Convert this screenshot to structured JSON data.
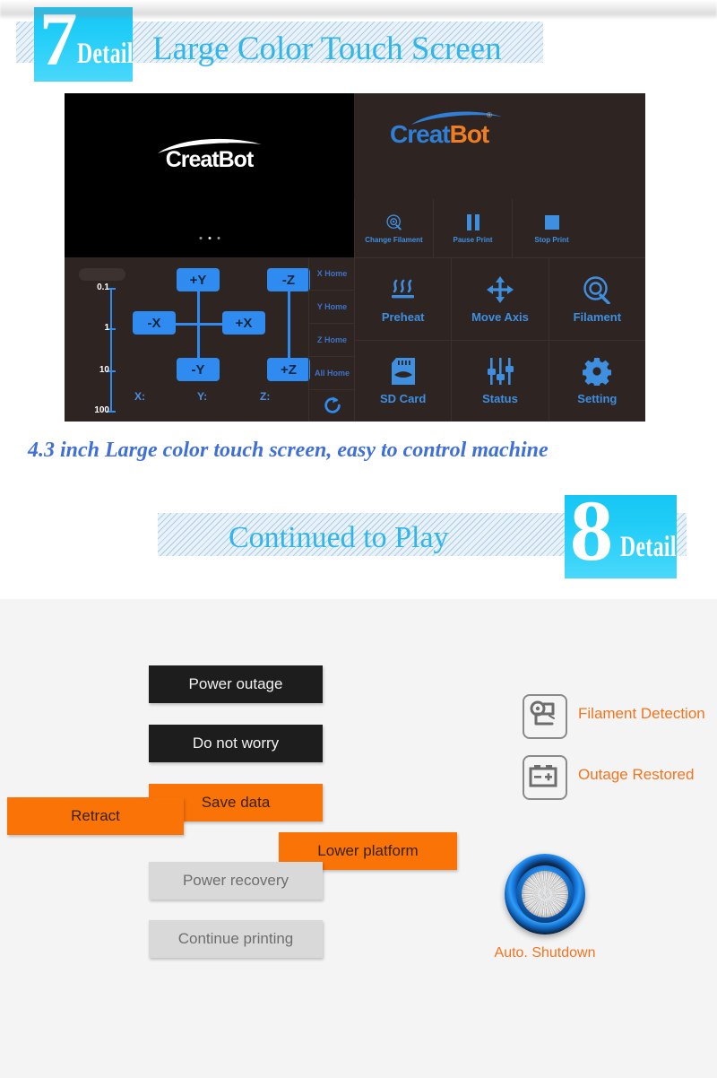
{
  "section7": {
    "number": "7",
    "detail_label": "Detail",
    "title": "Large Color Touch Screen",
    "caption": "4.3 inch Large color touch screen, easy to control machine"
  },
  "section8": {
    "number": "8",
    "detail_label": "Detail",
    "title": "Continued to Play"
  },
  "touchscreen": {
    "video_panel": {
      "brand": "CreatBot",
      "dots": [
        "dot",
        "dot-active",
        "dot"
      ]
    },
    "brand_panel": {
      "brand_first": "Creat",
      "brand_second": "Bot",
      "registered_mark": "®"
    },
    "top_buttons": [
      {
        "label": "Change Filament",
        "icon": "filament-spool-icon"
      },
      {
        "label": "Pause Print",
        "icon": "pause-icon"
      },
      {
        "label": "Stop Print",
        "icon": "stop-square-icon"
      }
    ],
    "menu_grid": [
      {
        "label": "Preheat",
        "icon": "heat-waves-icon"
      },
      {
        "label": "Move Axis",
        "icon": "four-way-arrows-icon"
      },
      {
        "label": "Filament",
        "icon": "filament-spool-icon"
      },
      {
        "label": "SD Card",
        "icon": "sd-card-icon"
      },
      {
        "label": "Status",
        "icon": "sliders-icon"
      },
      {
        "label": "Setting",
        "icon": "gear-icon"
      }
    ],
    "jog_panel": {
      "step_values": [
        "0.1",
        "1",
        "10",
        "100"
      ],
      "buttons": [
        "+Y",
        "-X",
        "+X",
        "-Y",
        "-Z",
        "+Z"
      ],
      "coordinates": [
        "X:",
        "Y:",
        "Z:"
      ],
      "home_buttons": [
        "X Home",
        "Y Home",
        "Z Home",
        "All Home"
      ],
      "refresh_icon": "refresh-icon"
    },
    "colors": {
      "accent_blue": "#2f8bf0",
      "label_blue": "#3e8fe0",
      "panel_dark": "#2e2523",
      "video_black": "#000000",
      "brand_orange": "#f07d22"
    }
  },
  "power_flow": {
    "steps": [
      {
        "label": "Power outage",
        "style": "black"
      },
      {
        "label": "Do not worry",
        "style": "black"
      },
      {
        "label": "Retract",
        "style": "orange"
      },
      {
        "label": "Save data",
        "style": "orange"
      },
      {
        "label": "Lower platform",
        "style": "orange"
      },
      {
        "label": "Power recovery",
        "style": "gray"
      },
      {
        "label": "Continue  printing",
        "style": "gray"
      }
    ],
    "features": [
      {
        "label": "Filament Detection",
        "icon": "filament-detection-icon"
      },
      {
        "label": "Outage Restored",
        "icon": "battery-icon"
      }
    ],
    "power_button": {
      "label": "Auto. Shutdown",
      "icon": "power-icon"
    },
    "colors": {
      "orange": "#f97306",
      "label_orange": "#f4741e",
      "black_box": "#1d1d1d",
      "gray_box": "#d9d9d9",
      "background": "#f4f4f4"
    }
  }
}
